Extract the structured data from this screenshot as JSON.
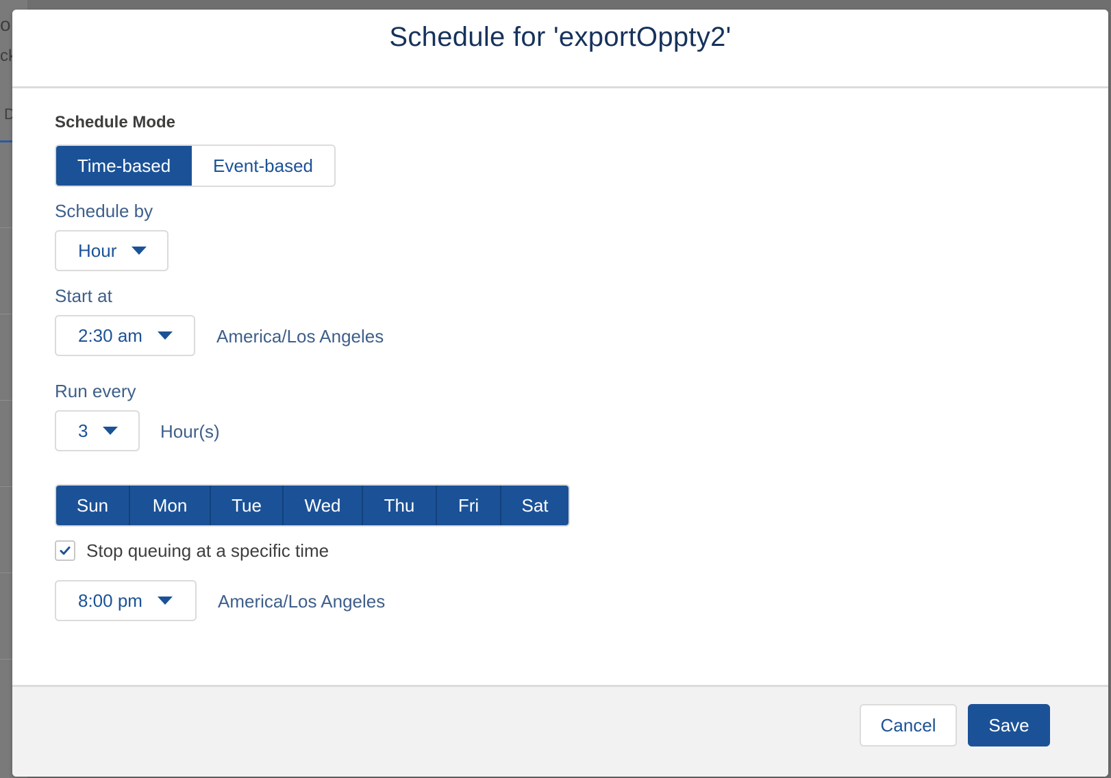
{
  "background": {
    "fragments": [
      "o",
      "ck",
      "D"
    ]
  },
  "modal": {
    "title": "Schedule for 'exportOppty2'",
    "schedule_mode": {
      "label": "Schedule Mode",
      "options": [
        "Time-based",
        "Event-based"
      ],
      "selected": "Time-based"
    },
    "schedule_by": {
      "label": "Schedule by",
      "value": "Hour"
    },
    "start_at": {
      "label": "Start at",
      "value": "2:30 am",
      "timezone": "America/Los Angeles"
    },
    "run_every": {
      "label": "Run every",
      "value": "3",
      "unit": "Hour(s)"
    },
    "days": [
      "Sun",
      "Mon",
      "Tue",
      "Wed",
      "Thu",
      "Fri",
      "Sat"
    ],
    "stop_queuing": {
      "label": "Stop queuing at a specific time",
      "checked": true,
      "value": "8:00 pm",
      "timezone": "America/Los Angeles"
    },
    "footer": {
      "cancel_label": "Cancel",
      "save_label": "Save"
    }
  },
  "colors": {
    "accent": "#1b5297",
    "label_text": "#3e5f8a",
    "border": "#dddbda",
    "footer_bg": "#f3f2f2",
    "overlay": "#6f6f6f"
  }
}
